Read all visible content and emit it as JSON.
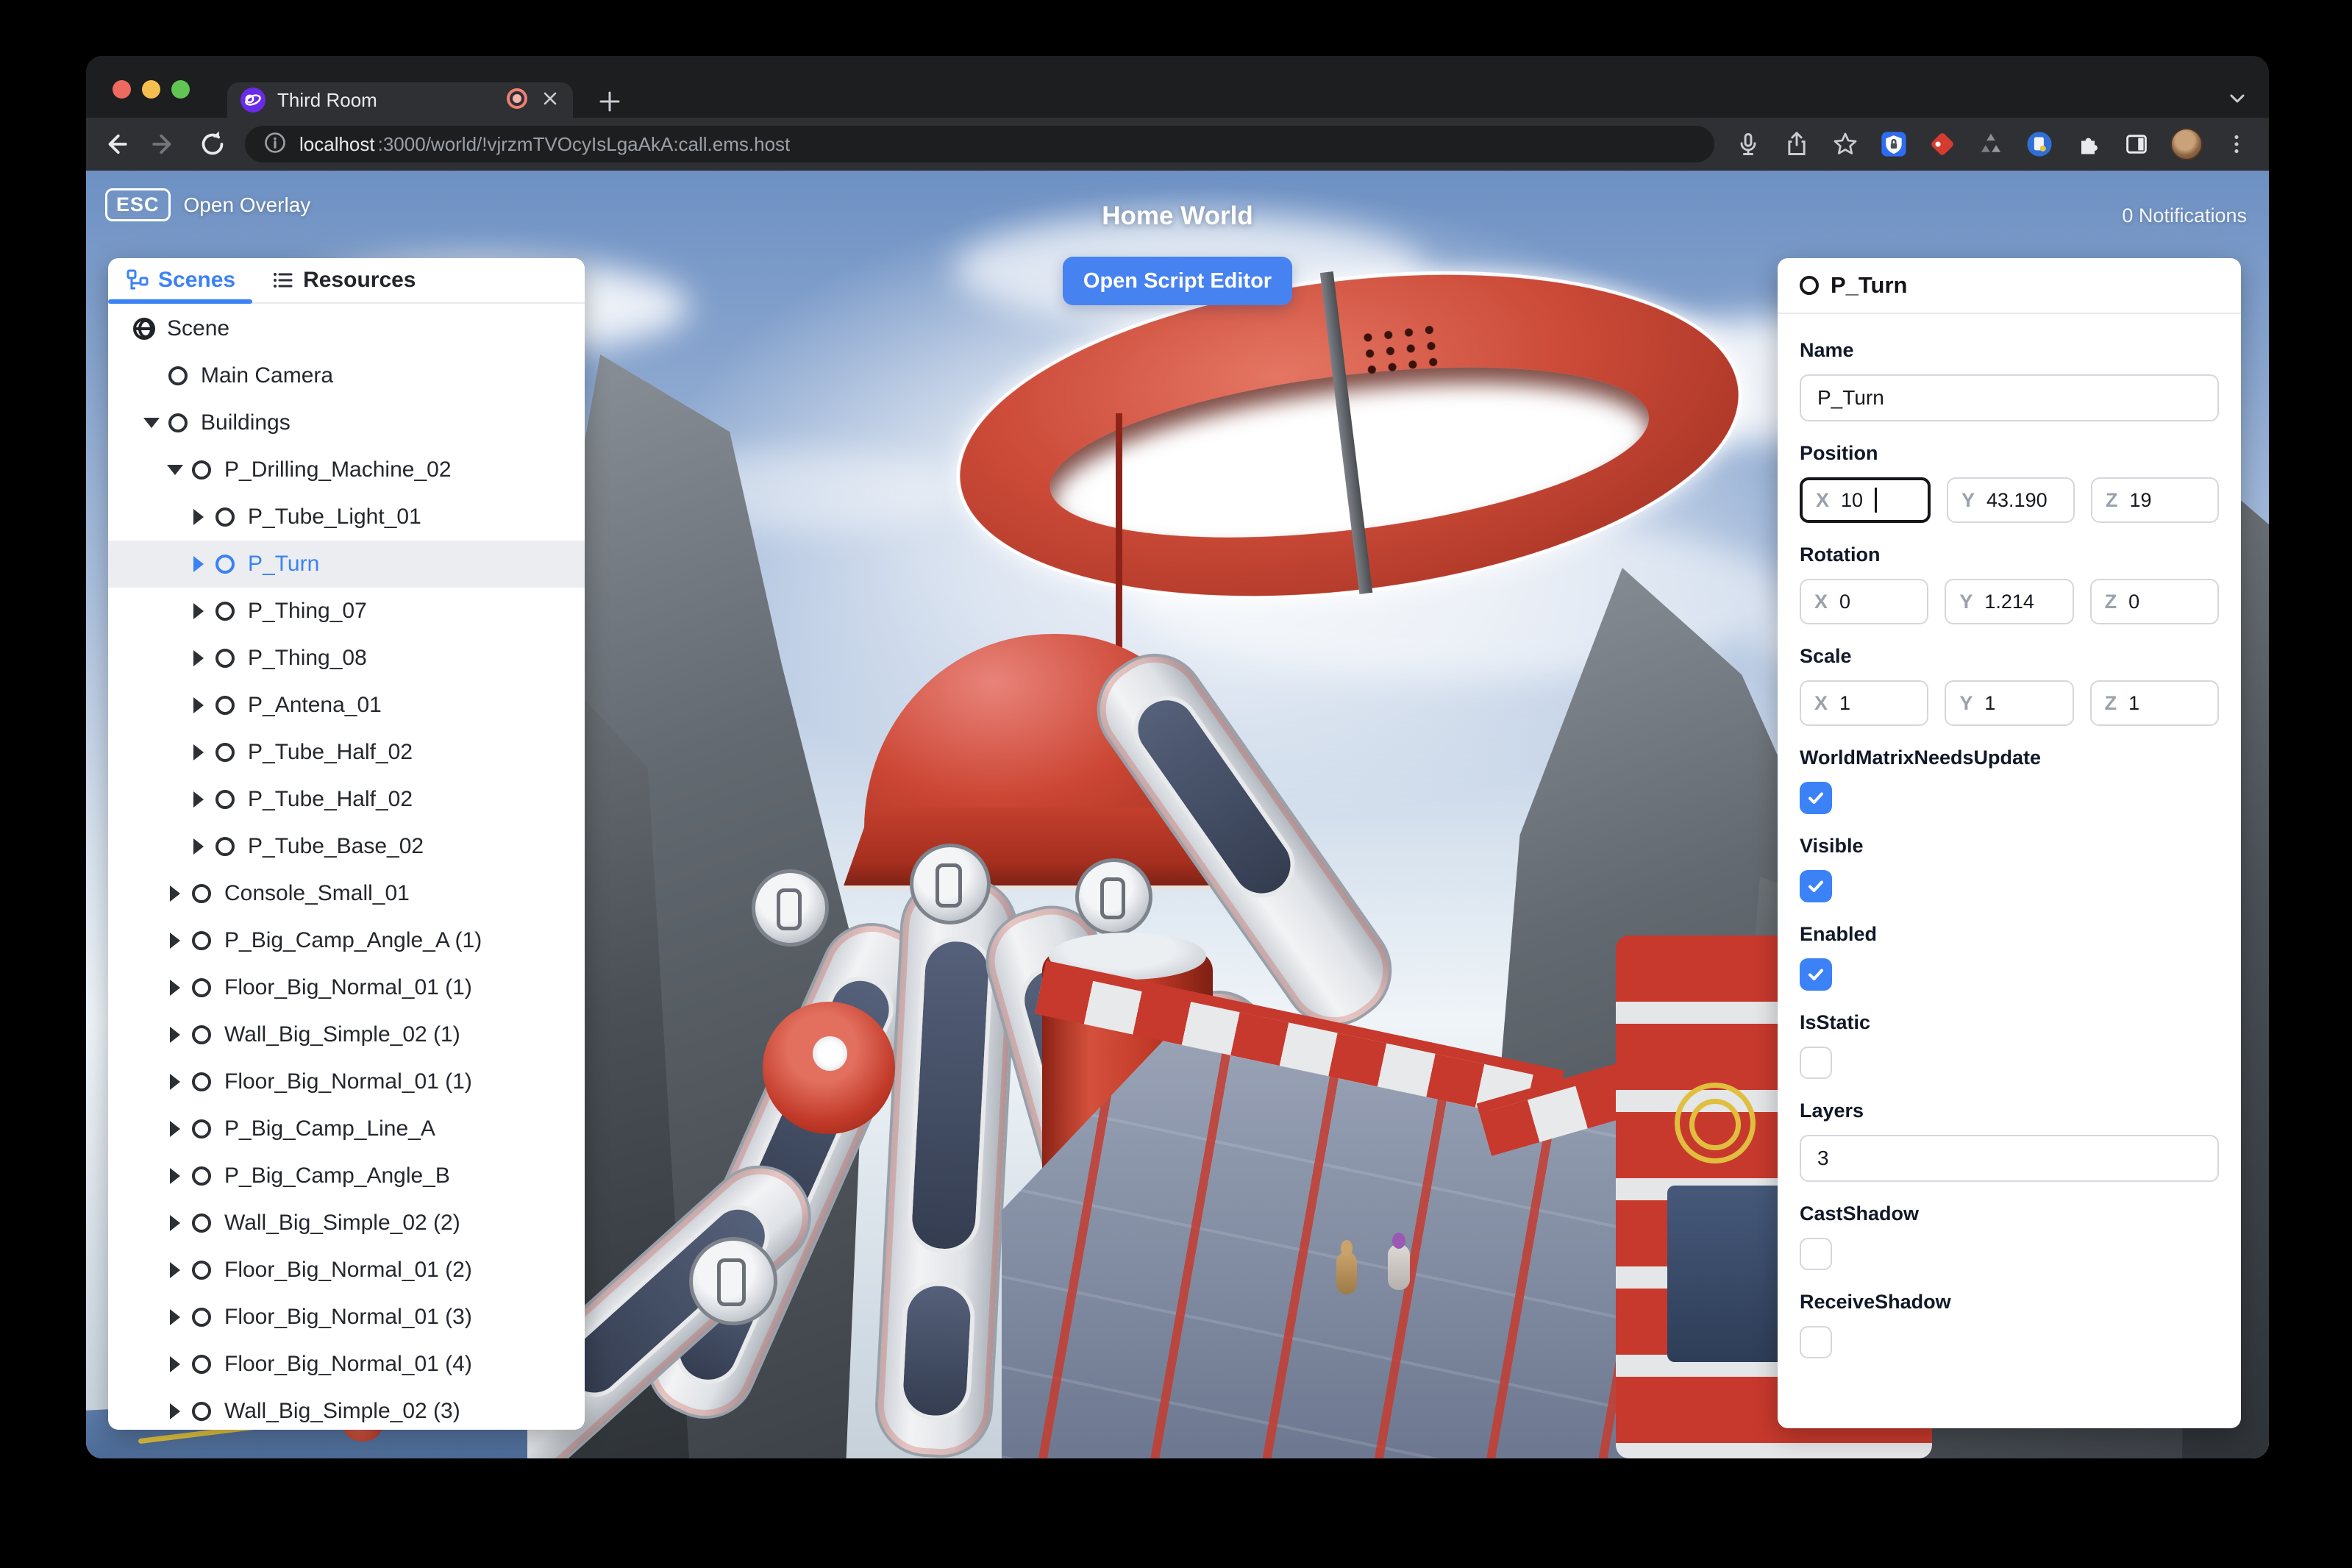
{
  "browser": {
    "window_controls": [
      "close",
      "minimize",
      "zoom"
    ],
    "tab": {
      "title": "Third Room",
      "favicon": "third-room-logo",
      "indicator": "tab-recording-indicator",
      "close": "close-icon"
    },
    "new_tab_label": "+",
    "nav": {
      "back": "back-arrow-icon",
      "forward": "forward-arrow-icon",
      "reload": "reload-icon"
    },
    "url": {
      "info_icon": "site-info-icon",
      "host": "localhost",
      "rest": ":3000/world/!vjrzmTVOcyIsLgaAkA:call.ems.host"
    },
    "toolbar_icons": [
      "microphone-icon",
      "share-icon",
      "bookmark-star-icon",
      "shield-extension-icon",
      "red-extension-icon",
      "recycle-extension-icon",
      "notes-extension-icon",
      "extensions-puzzle-icon",
      "sidebar-toggle-icon",
      "profile-avatar",
      "menu-dots-icon"
    ]
  },
  "hud": {
    "esc_key": "ESC",
    "esc_label": "Open Overlay",
    "title": "Home World",
    "notifications": "0 Notifications",
    "script_editor_button": "Open Script Editor"
  },
  "left_panel": {
    "tabs": [
      {
        "label": "Scenes",
        "icon": "hierarchy-icon",
        "active": true
      },
      {
        "label": "Resources",
        "icon": "list-icon",
        "active": false
      }
    ],
    "tree": [
      {
        "label": "Scene",
        "depth": 0,
        "icon": "globe",
        "arrow": "none",
        "selected": false
      },
      {
        "label": "Main Camera",
        "depth": 1,
        "icon": "circle",
        "arrow": "space",
        "selected": false
      },
      {
        "label": "Buildings",
        "depth": 1,
        "icon": "circle",
        "arrow": "down",
        "selected": false
      },
      {
        "label": "P_Drilling_Machine_02",
        "depth": 2,
        "icon": "circle",
        "arrow": "down",
        "selected": false
      },
      {
        "label": "P_Tube_Light_01",
        "depth": 3,
        "icon": "circle",
        "arrow": "right",
        "selected": false
      },
      {
        "label": "P_Turn",
        "depth": 3,
        "icon": "circle",
        "arrow": "right",
        "selected": true
      },
      {
        "label": "P_Thing_07",
        "depth": 3,
        "icon": "circle",
        "arrow": "right",
        "selected": false
      },
      {
        "label": "P_Thing_08",
        "depth": 3,
        "icon": "circle",
        "arrow": "right",
        "selected": false
      },
      {
        "label": "P_Antena_01",
        "depth": 3,
        "icon": "circle",
        "arrow": "right",
        "selected": false
      },
      {
        "label": "P_Tube_Half_02",
        "depth": 3,
        "icon": "circle",
        "arrow": "right",
        "selected": false
      },
      {
        "label": "P_Tube_Half_02",
        "depth": 3,
        "icon": "circle",
        "arrow": "right",
        "selected": false
      },
      {
        "label": "P_Tube_Base_02",
        "depth": 3,
        "icon": "circle",
        "arrow": "right",
        "selected": false
      },
      {
        "label": "Console_Small_01",
        "depth": 2,
        "icon": "circle",
        "arrow": "right",
        "selected": false
      },
      {
        "label": "P_Big_Camp_Angle_A (1)",
        "depth": 2,
        "icon": "circle",
        "arrow": "right",
        "selected": false
      },
      {
        "label": "Floor_Big_Normal_01 (1)",
        "depth": 2,
        "icon": "circle",
        "arrow": "right",
        "selected": false
      },
      {
        "label": "Wall_Big_Simple_02 (1)",
        "depth": 2,
        "icon": "circle",
        "arrow": "right",
        "selected": false
      },
      {
        "label": "Floor_Big_Normal_01 (1)",
        "depth": 2,
        "icon": "circle",
        "arrow": "right",
        "selected": false
      },
      {
        "label": "P_Big_Camp_Line_A",
        "depth": 2,
        "icon": "circle",
        "arrow": "right",
        "selected": false
      },
      {
        "label": "P_Big_Camp_Angle_B",
        "depth": 2,
        "icon": "circle",
        "arrow": "right",
        "selected": false
      },
      {
        "label": "Wall_Big_Simple_02 (2)",
        "depth": 2,
        "icon": "circle",
        "arrow": "right",
        "selected": false
      },
      {
        "label": "Floor_Big_Normal_01 (2)",
        "depth": 2,
        "icon": "circle",
        "arrow": "right",
        "selected": false
      },
      {
        "label": "Floor_Big_Normal_01 (3)",
        "depth": 2,
        "icon": "circle",
        "arrow": "right",
        "selected": false
      },
      {
        "label": "Floor_Big_Normal_01 (4)",
        "depth": 2,
        "icon": "circle",
        "arrow": "right",
        "selected": false
      },
      {
        "label": "Wall_Big_Simple_02 (3)",
        "depth": 2,
        "icon": "circle",
        "arrow": "right",
        "selected": false
      }
    ]
  },
  "right_panel": {
    "header": {
      "icon": "entity-circle-icon",
      "title": "P_Turn"
    },
    "fields": [
      {
        "type": "text",
        "label": "Name",
        "value": "P_Turn"
      },
      {
        "type": "vector",
        "label": "Position",
        "axes": [
          {
            "axis": "X",
            "value": "10",
            "focused": true
          },
          {
            "axis": "Y",
            "value": "43.190",
            "focused": false
          },
          {
            "axis": "Z",
            "value": "19",
            "focused": false
          }
        ]
      },
      {
        "type": "vector",
        "label": "Rotation",
        "axes": [
          {
            "axis": "X",
            "value": "0",
            "focused": false
          },
          {
            "axis": "Y",
            "value": "1.214",
            "focused": false
          },
          {
            "axis": "Z",
            "value": "0",
            "focused": false
          }
        ]
      },
      {
        "type": "vector",
        "label": "Scale",
        "axes": [
          {
            "axis": "X",
            "value": "1",
            "focused": false
          },
          {
            "axis": "Y",
            "value": "1",
            "focused": false
          },
          {
            "axis": "Z",
            "value": "1",
            "focused": false
          }
        ]
      },
      {
        "type": "checkbox",
        "label": "WorldMatrixNeedsUpdate",
        "checked": true
      },
      {
        "type": "checkbox",
        "label": "Visible",
        "checked": true
      },
      {
        "type": "checkbox",
        "label": "Enabled",
        "checked": true
      },
      {
        "type": "checkbox",
        "label": "IsStatic",
        "checked": false
      },
      {
        "type": "text",
        "label": "Layers",
        "value": "3"
      },
      {
        "type": "checkbox",
        "label": "CastShadow",
        "checked": false
      },
      {
        "type": "checkbox",
        "label": "ReceiveShadow",
        "checked": false
      }
    ]
  },
  "colors": {
    "accent_blue": "#3b82f6",
    "button_blue": "#4783f0",
    "checkbox_blue": "#3b82f6",
    "selected_row_bg": "#ebedf0",
    "machine_red": "#c8392d",
    "favicon_purple": "#6a2be8",
    "chrome_dark": "#1d1e20",
    "chrome_toolbar": "#2e3033"
  }
}
